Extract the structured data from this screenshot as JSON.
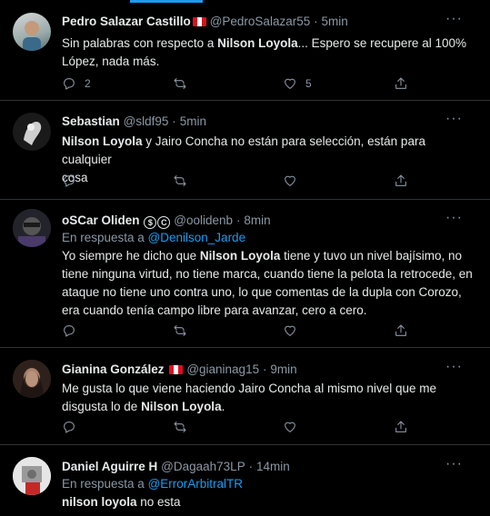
{
  "tweets": [
    {
      "name": "Pedro Salazar Castillo",
      "handle": "@PedroSalazar55",
      "sep": "·",
      "time": "5min",
      "text_lines": [
        [
          "Sin palabras con respecto a ",
          "Nilson Loyola",
          "... Espero se recupere al 100%"
        ],
        [
          "López, nada más.",
          "",
          ""
        ]
      ],
      "reply_count": "2",
      "retweet_count": "",
      "like_count": "5"
    },
    {
      "name": "Sebastian",
      "handle": "@sldf95",
      "sep": "·",
      "time": "5min",
      "text_lines": [
        [
          "",
          "Nilson Loyola",
          " y Jairo Concha no están para selección, están para cualquier"
        ],
        [
          "cosa",
          "",
          ""
        ]
      ],
      "reply_count": "",
      "retweet_count": "",
      "like_count": ""
    },
    {
      "name": "oSCar Oliden",
      "badges": [
        "$",
        "C"
      ],
      "handle": "@oolidenb",
      "sep": "·",
      "time": "8min",
      "reply_prefix": "En respuesta a ",
      "reply_to": "@Denilson_Jarde",
      "text_lines": [
        [
          "Yo siempre he dicho que ",
          "Nilson Loyola",
          " tiene y tuvo un nivel bajísimo, no"
        ],
        [
          "tiene ninguna virtud, no tiene marca, cuando tiene la pelota la retrocede, en",
          "",
          ""
        ],
        [
          "ataque no tiene uno contra uno, lo que comentas de la dupla con Corozo,",
          "",
          ""
        ],
        [
          "era cuando tenía campo libre para avanzar, cero a cero.",
          "",
          ""
        ]
      ],
      "reply_count": "",
      "retweet_count": "",
      "like_count": ""
    },
    {
      "name": "Gianina González",
      "handle": "@gianinag15",
      "sep": "·",
      "time": "9min",
      "text_lines": [
        [
          "Me gusta lo que viene haciendo Jairo Concha al mismo nivel que me",
          "",
          ""
        ],
        [
          "disgusta lo de ",
          "Nilson Loyola",
          "."
        ]
      ],
      "reply_count": "",
      "retweet_count": "",
      "like_count": ""
    },
    {
      "name": "Daniel Aguirre H",
      "handle": "@Dagaah73LP",
      "sep": "·",
      "time": "14min",
      "reply_prefix": "En respuesta a ",
      "reply_to": "@ErrorArbitralTR",
      "text_lines": [
        [
          "",
          "nilson loyola",
          " no esta"
        ]
      ]
    }
  ],
  "more_label": "···",
  "colors": {
    "background": "#000000",
    "accent": "#1d9bf0",
    "muted": "#8b98a5",
    "divider": "#2f3336"
  },
  "icons": [
    "reply-icon",
    "retweet-icon",
    "like-icon",
    "share-icon",
    "more-icon",
    "peru-flag-icon"
  ]
}
